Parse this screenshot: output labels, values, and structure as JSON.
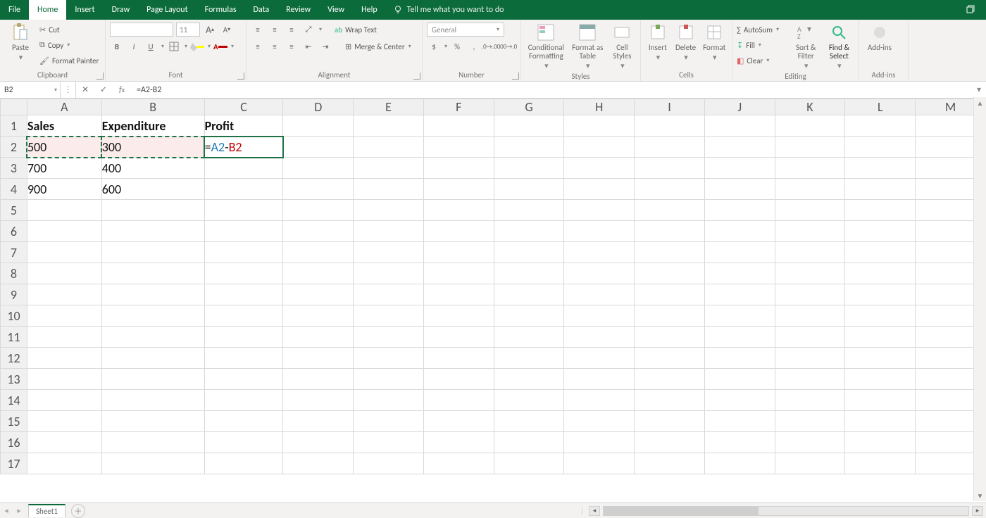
{
  "menu": {
    "file": "File",
    "home": "Home",
    "insert": "Insert",
    "draw": "Draw",
    "pageLayout": "Page Layout",
    "formulas": "Formulas",
    "data": "Data",
    "review": "Review",
    "view": "View",
    "help": "Help",
    "tellme": "Tell me what you want to do"
  },
  "ribbon": {
    "clipboard": {
      "paste": "Paste",
      "cut": "Cut",
      "copy": "Copy",
      "formatPainter": "Format Painter",
      "label": "Clipboard"
    },
    "font": {
      "size": "11",
      "increase": "A",
      "decrease": "A",
      "bold": "B",
      "italic": "I",
      "underline": "U",
      "label": "Font"
    },
    "alignment": {
      "wrap": "Wrap Text",
      "merge": "Merge & Center",
      "label": "Alignment"
    },
    "number": {
      "format": "General",
      "label": "Number"
    },
    "styles": {
      "cond": "Conditional Formatting",
      "fmtTable": "Format as Table",
      "cellStyles": "Cell Styles",
      "label": "Styles"
    },
    "cells": {
      "insert": "Insert",
      "delete": "Delete",
      "format": "Format",
      "label": "Cells"
    },
    "editing": {
      "autosum": "AutoSum",
      "fill": "Fill",
      "clear": "Clear",
      "sort": "Sort & Filter",
      "find": "Find & Select",
      "label": "Editing"
    },
    "addins": {
      "addins": "Add-ins",
      "label": "Add-ins"
    }
  },
  "formulaBar": {
    "nameBox": "B2",
    "formula": "=A2-B2"
  },
  "columns": [
    "A",
    "B",
    "C",
    "D",
    "E",
    "F",
    "G",
    "H",
    "I",
    "J",
    "K",
    "L",
    "M"
  ],
  "rows": [
    1,
    2,
    3,
    4,
    5,
    6,
    7,
    8,
    9,
    10,
    11,
    12,
    13,
    14,
    15,
    16,
    17
  ],
  "cells": {
    "A1": "Sales",
    "B1": "Expenditure",
    "C1": "Profit",
    "A2": "500",
    "B2": "300",
    "C2": "=A2-B2",
    "A3": "700",
    "B3": "400",
    "A4": "900",
    "B4": "600"
  },
  "activeCell": "C2",
  "marqueeCells": [
    "A2",
    "B2"
  ],
  "sheet": {
    "name": "Sheet1"
  }
}
